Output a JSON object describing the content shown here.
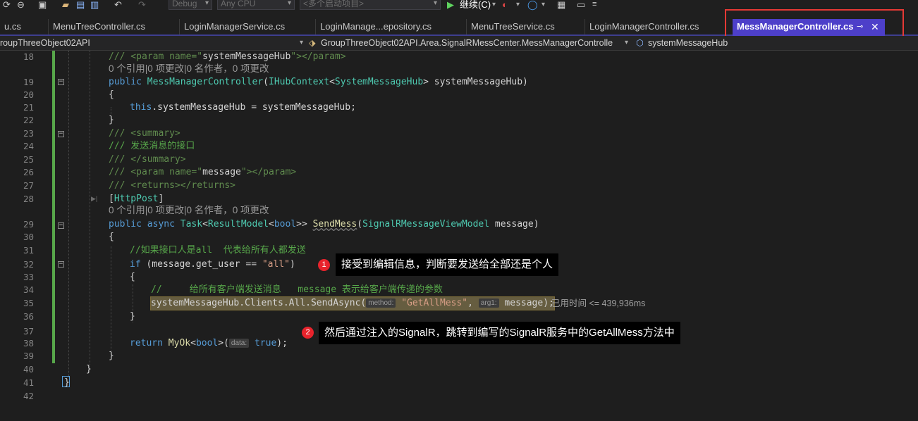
{
  "toolbar": {
    "config_combo": "Debug",
    "platform_combo": "Any CPU",
    "startup_combo": "<多个启动项目>",
    "continue_label": "继续(C)"
  },
  "tabs": [
    {
      "label": "u.cs"
    },
    {
      "label": "MenuTreeController.cs"
    },
    {
      "label": "LoginManagerService.cs"
    },
    {
      "label": "LoginManage...epository.cs"
    },
    {
      "label": "MenuTreeService.cs"
    },
    {
      "label": "LoginManagerController.cs"
    },
    {
      "label": "MessManagerController.cs"
    }
  ],
  "navbar": {
    "project": "roupThreeObject02API",
    "class_path": "GroupThreeObject02API.Area.SignalRMessCenter.MessManagerControlle",
    "member": "systemMessageHub"
  },
  "lines": {
    "n18": "18",
    "n19": "19",
    "n20": "20",
    "n21": "21",
    "n22": "22",
    "n23": "23",
    "n24": "24",
    "n25": "25",
    "n26": "26",
    "n27": "27",
    "n28": "28",
    "n29": "29",
    "n30": "30",
    "n31": "31",
    "n32": "32",
    "n33": "33",
    "n34": "34",
    "n35": "35",
    "n36": "36",
    "n37": "37",
    "n38": "38",
    "n39": "39",
    "n40": "40",
    "n41": "41",
    "n42": "42"
  },
  "code": {
    "l18_a": "/// <param name=\"",
    "l18_b": "systemMessageHub",
    "l18_c": "\"></param>",
    "lens1": "0 个引用|0 项更改|0 名作者，0 项更改",
    "l19_public": "public",
    "l19_name": "MessManagerController",
    "l19_open": "(",
    "l19_type1": "IHubContext",
    "l19_lt": "<",
    "l19_type2": "SystemMessageHub",
    "l19_rest": "> systemMessageHub)",
    "l20": "{",
    "l21_this": "this",
    "l21_rest": ".systemMessageHub = systemMessageHub;",
    "l22": "}",
    "l23": "/// <summary>",
    "l24": "/// 发送消息的接口",
    "l25": "/// </summary>",
    "l26_a": "/// <param name=\"",
    "l26_b": "message",
    "l26_c": "\"></param>",
    "l27": "/// <returns></returns>",
    "l28_a": "[",
    "l28_b": "HttpPost",
    "l28_c": "]",
    "lens2": "0 个引用|0 项更改|0 名作者，0 项更改",
    "l29_kw": "public async",
    "l29_task": "Task",
    "l29_lt": "<",
    "l29_rm": "ResultModel",
    "l29_lt2": "<",
    "l29_bool": "bool",
    "l29_gt": ">> ",
    "l29_method": "SendMess",
    "l29_open": "(",
    "l29_ptype": "SignalRMessageViewModel",
    "l29_rest": " message)",
    "l30": "{",
    "l31": "//如果接口人是all  代表给所有人都发送",
    "l32_if": "if",
    "l32_mid": " (message.get_user == ",
    "l32_str": "\"all\"",
    "l32_end": ")",
    "l33": "{",
    "l34": "//     给所有客户端发送消息   message 表示给客户端传递的参数",
    "l35_a": "systemMessageHub.Clients.All.SendAsync(",
    "l35_hint1": "method:",
    "l35_str": "\"GetAllMess\"",
    "l35_comma": ", ",
    "l35_hint2": "arg1:",
    "l35_b": " message);",
    "l35_elapsed": "已用时间 <= 439,936ms",
    "l36": "}",
    "l38_return": "return",
    "l38_myok": "MyOk",
    "l38_lt": "<",
    "l38_bool": "bool",
    "l38_gt": ">(",
    "l38_hint": "data:",
    "l38_true": "true",
    "l38_end": ");",
    "l39": "}",
    "l40": "}",
    "l41": "}"
  },
  "annotations": [
    {
      "number": "1",
      "text": "接受到编辑信息，判断要发送给全部还是个人"
    },
    {
      "number": "2",
      "text": "然后通过注入的SignalR，跳转到编写的SignalR服务中的GetAllMess方法中"
    }
  ],
  "colors": {
    "comment": "#57a64a",
    "keyword": "#569cd6",
    "type": "#4ec9b0",
    "string": "#d69d85",
    "active_tab": "#4d3fc9",
    "red_highlight": "#e53935"
  }
}
